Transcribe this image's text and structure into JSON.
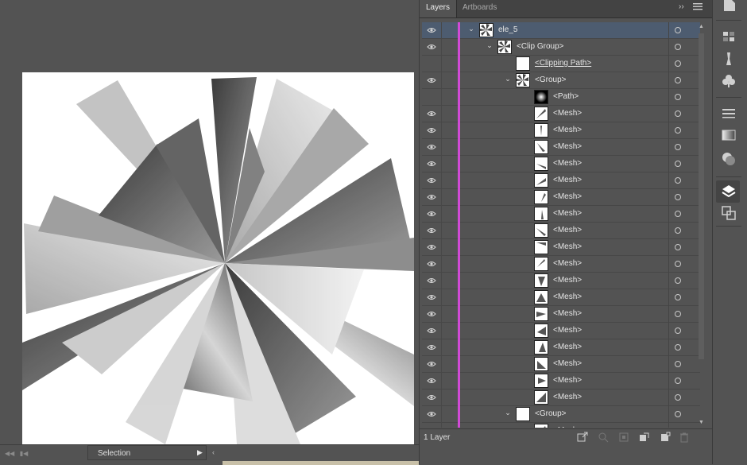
{
  "panel": {
    "tabs": [
      {
        "label": "Layers",
        "active": true
      },
      {
        "label": "Artboards",
        "active": false
      }
    ],
    "collapse_glyph": "››",
    "menu_icon": "hamburger-menu-icon"
  },
  "layers": [
    {
      "name": "ele_5",
      "indent": 0,
      "expanded": true,
      "visible": true,
      "thumb": "fan",
      "selected": true
    },
    {
      "name": "<Clip Group>",
      "indent": 1,
      "expanded": true,
      "visible": true,
      "thumb": "fan"
    },
    {
      "name": "<Clipping Path>",
      "indent": 2,
      "visible": false,
      "thumb": "blank",
      "underline": true
    },
    {
      "name": "<Group>",
      "indent": 2,
      "expanded": true,
      "visible": true,
      "thumb": "fan"
    },
    {
      "name": "<Path>",
      "indent": 3,
      "visible": false,
      "thumb": "radial"
    },
    {
      "name": "<Mesh>",
      "indent": 3,
      "visible": true,
      "thumb": "mesh1"
    },
    {
      "name": "<Mesh>",
      "indent": 3,
      "visible": true,
      "thumb": "mesh2"
    },
    {
      "name": "<Mesh>",
      "indent": 3,
      "visible": true,
      "thumb": "mesh3"
    },
    {
      "name": "<Mesh>",
      "indent": 3,
      "visible": true,
      "thumb": "mesh4"
    },
    {
      "name": "<Mesh>",
      "indent": 3,
      "visible": true,
      "thumb": "mesh5"
    },
    {
      "name": "<Mesh>",
      "indent": 3,
      "visible": true,
      "thumb": "mesh6"
    },
    {
      "name": "<Mesh>",
      "indent": 3,
      "visible": true,
      "thumb": "mesh7"
    },
    {
      "name": "<Mesh>",
      "indent": 3,
      "visible": true,
      "thumb": "mesh8"
    },
    {
      "name": "<Mesh>",
      "indent": 3,
      "visible": true,
      "thumb": "mesh9"
    },
    {
      "name": "<Mesh>",
      "indent": 3,
      "visible": true,
      "thumb": "mesh10"
    },
    {
      "name": "<Mesh>",
      "indent": 3,
      "visible": true,
      "thumb": "mesh11"
    },
    {
      "name": "<Mesh>",
      "indent": 3,
      "visible": true,
      "thumb": "mesh12"
    },
    {
      "name": "<Mesh>",
      "indent": 3,
      "visible": true,
      "thumb": "mesh13"
    },
    {
      "name": "<Mesh>",
      "indent": 3,
      "visible": true,
      "thumb": "mesh14"
    },
    {
      "name": "<Mesh>",
      "indent": 3,
      "visible": true,
      "thumb": "mesh15"
    },
    {
      "name": "<Mesh>",
      "indent": 3,
      "visible": true,
      "thumb": "mesh16"
    },
    {
      "name": "<Mesh>",
      "indent": 3,
      "visible": true,
      "thumb": "mesh17"
    },
    {
      "name": "<Mesh>",
      "indent": 3,
      "visible": true,
      "thumb": "mesh18"
    },
    {
      "name": "<Group>",
      "indent": 2,
      "expanded": true,
      "visible": true,
      "thumb": "blank"
    },
    {
      "name": "<Mesh>",
      "indent": 3,
      "visible": true,
      "thumb": "mesh1"
    }
  ],
  "footer": {
    "layer_count": "1 Layer",
    "icons": [
      "export-for-screens-icon",
      "locate-object-icon",
      "make-clipping-mask-icon",
      "create-sublayer-icon",
      "new-layer-icon",
      "delete-icon"
    ]
  },
  "status": {
    "tool_name": "Selection"
  },
  "rail_icons": [
    "properties-icon",
    "swatches-icon",
    "brushes-icon",
    "symbols-icon",
    "stroke-icon",
    "gradient-icon",
    "transparency-icon",
    "layers-icon",
    "pathfinder-icon"
  ],
  "colors": {
    "selection_row": "#4d5c70",
    "layer_color_bar": "#d14ad6",
    "panel_bg": "#535353"
  }
}
